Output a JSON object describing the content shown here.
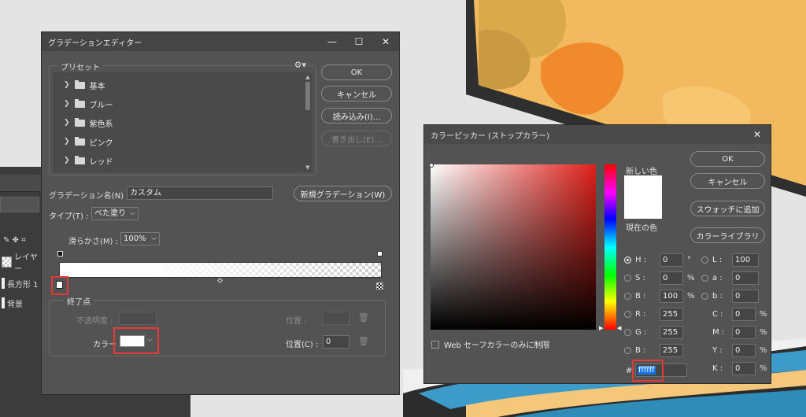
{
  "background_layers_panel": {
    "layer_partial": "レイヤー",
    "layers": [
      "長方形 1",
      "背景"
    ]
  },
  "gradient_editor": {
    "title": "グラデーションエディター",
    "presets": {
      "label": "プリセット",
      "folders": [
        "基本",
        "ブルー",
        "紫色系",
        "ピンク",
        "レッド"
      ]
    },
    "buttons": {
      "ok": "OK",
      "cancel": "キャンセル",
      "load": "読み込み(I)...",
      "save": "書き出し(E)..."
    },
    "name_label": "グラデーション名(N) :",
    "name_value": "カスタム",
    "new_gradient": "新規グラデーション(W)",
    "type_label": "タイプ(T) :",
    "type_value": "べた塗り",
    "smoothness_label": "滑らかさ(M) :",
    "smoothness_value": "100%",
    "stops": {
      "label": "終了点",
      "opacity_label": "不透明度 :",
      "opacity_location_label": "位置 :",
      "color_label": "カラー :",
      "color_location_label": "位置(C) :",
      "color_location_value": "0",
      "color_value": "#ffffff"
    }
  },
  "color_picker": {
    "title": "カラーピッカー (ストップカラー)",
    "new_label": "新しい色",
    "current_label": "現在の色",
    "buttons": {
      "ok": "OK",
      "cancel": "キャンセル",
      "add_swatch": "スウォッチに追加",
      "libraries": "カラーライブラリ"
    },
    "hsb": {
      "h_label": "H :",
      "h": "0",
      "h_unit": "°",
      "s_label": "S :",
      "s": "0",
      "s_unit": "%",
      "b_label": "B :",
      "b": "100",
      "b_unit": "%"
    },
    "lab": {
      "l_label": "L :",
      "l": "100",
      "a_label": "a :",
      "a": "0",
      "b_label": "b :",
      "b": "0"
    },
    "rgb": {
      "r_label": "R :",
      "r": "255",
      "g_label": "G :",
      "g": "255",
      "b_label": "B :",
      "b": "255"
    },
    "cmyk": {
      "c_label": "C :",
      "c": "0",
      "m_label": "M :",
      "m": "0",
      "y_label": "Y :",
      "y": "0",
      "k_label": "K :",
      "k": "0",
      "unit": "%"
    },
    "web_only_label": "Web セーフカラーのみに制限",
    "hex_label": "#",
    "hex_value": "ffffff"
  },
  "colors": {
    "dialog_bg": "#535353",
    "title_bg": "#454545",
    "highlight_red": "#e53935",
    "selection_blue": "#1473e6"
  }
}
